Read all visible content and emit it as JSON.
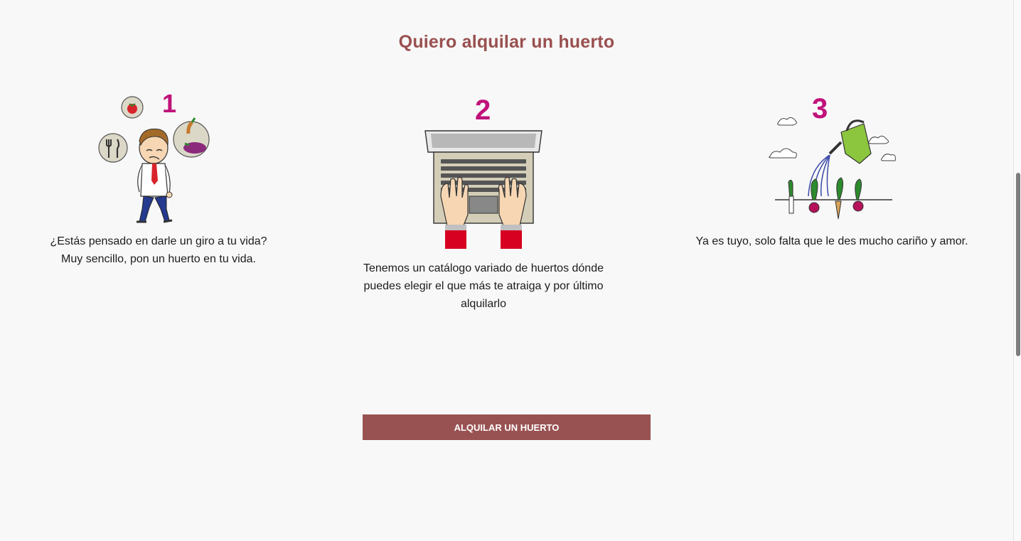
{
  "title": "Quiero alquilar un huerto",
  "steps": [
    {
      "number": "1",
      "text_lines": [
        "¿Estás pensado en darle un giro a tu vida?",
        "Muy sencillo, pon un huerto en tu vida."
      ]
    },
    {
      "number": "2",
      "text_lines": [
        "Tenemos un catálogo variado de huertos dónde",
        "puedes elegir el que más te atraiga y por último",
        "alquilarlo"
      ]
    },
    {
      "number": "3",
      "text_lines": [
        "Ya es tuyo, solo falta que le des mucho cariño y amor."
      ]
    }
  ],
  "cta": {
    "label": "ALQUILAR UN HUERTO"
  },
  "colors": {
    "brand": "#99504f",
    "number": "#c0127a",
    "background": "#f8f8f8"
  },
  "scrollbar": {
    "position_fraction": 0.32
  }
}
